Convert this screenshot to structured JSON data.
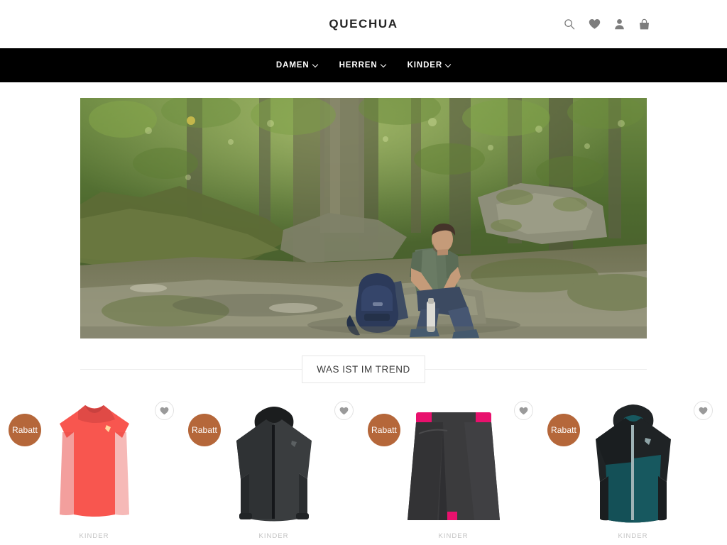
{
  "header": {
    "brand": "QUECHUA",
    "icons": [
      {
        "name": "search-icon",
        "label": "Suche"
      },
      {
        "name": "heart-icon",
        "label": "Wunschliste"
      },
      {
        "name": "user-icon",
        "label": "Konto"
      },
      {
        "name": "bag-icon",
        "label": "Warenkorb"
      }
    ]
  },
  "nav": {
    "items": [
      {
        "label": "DAMEN",
        "caret": "chevron-down-icon"
      },
      {
        "label": "HERREN",
        "caret": "chevron-down-icon"
      },
      {
        "label": "KINDER",
        "caret": "chevron-down-icon"
      }
    ]
  },
  "hero": {
    "alt": "Mann sitzt auf Felsen im Wald mit Rucksack und Trinkflasche",
    "colors": {
      "canopy": "#3f5126",
      "foliage": "#55702f",
      "trunk": "#5d5a43",
      "rock": "#8d8c78",
      "moss": "#6d7f3e",
      "shirt": "#5d6f5a",
      "jeans": "#46546b",
      "pack": "#2c3a5a",
      "bottle": "#d8d8d4",
      "skin": "#c49a78"
    }
  },
  "section": {
    "title": "WAS IST IM TREND"
  },
  "products": [
    {
      "badge": "Rabatt",
      "category": "KINDER",
      "wishlist_icon": "heart-icon",
      "type": "tshirt",
      "colors": {
        "main": "#f8564f",
        "shade": "#e04a46",
        "accent": "#ffd8a0"
      }
    },
    {
      "badge": "Rabatt",
      "category": "KINDER",
      "wishlist_icon": "heart-icon",
      "type": "padded-jacket",
      "colors": {
        "main": "#3a3d3f",
        "shade": "#2b2e30",
        "accent": "#1b1d1e"
      }
    },
    {
      "badge": "Rabatt",
      "category": "KINDER",
      "wishlist_icon": "heart-icon",
      "type": "skort",
      "colors": {
        "main": "#3b3b3d",
        "shade": "#2e2e30",
        "accent": "#e8116d"
      }
    },
    {
      "badge": "Rabatt",
      "category": "KINDER",
      "wishlist_icon": "heart-icon",
      "type": "rain-jacket",
      "colors": {
        "main": "#17585f",
        "shade": "#1f2325",
        "accent": "#9fb3b6"
      }
    }
  ]
}
